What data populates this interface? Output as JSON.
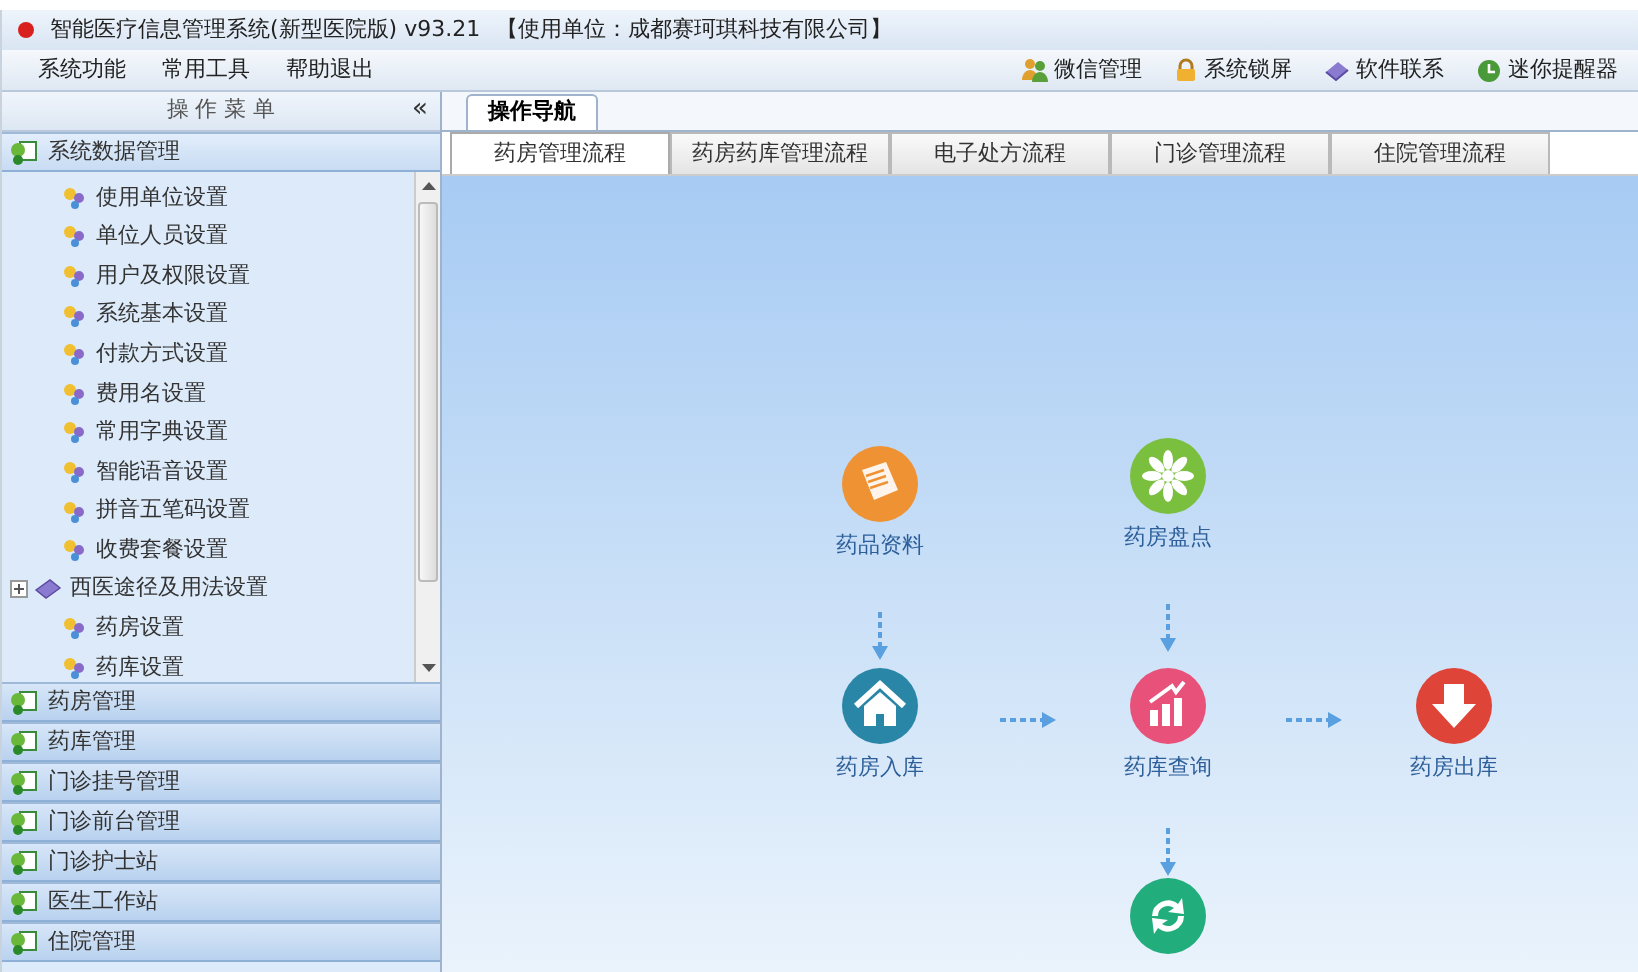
{
  "window": {
    "title": "智能医疗信息管理系统(新型医院版) v93.21",
    "unit": "【使用单位：成都赛珂琪科技有限公司】"
  },
  "menu": [
    "系统功能",
    "常用工具",
    "帮助退出"
  ],
  "toolbar": [
    {
      "label": "微信管理",
      "kind": "people"
    },
    {
      "label": "系统锁屏",
      "kind": "lock"
    },
    {
      "label": "软件联系",
      "kind": "gem"
    },
    {
      "label": "迷你提醒器",
      "kind": "clock"
    }
  ],
  "sidebar": {
    "header": "操 作 菜 单",
    "collapse": "«",
    "groups": [
      {
        "label": "系统数据管理",
        "expanded": true,
        "items": [
          {
            "label": "使用单位设置",
            "kind": "setting"
          },
          {
            "label": "单位人员设置",
            "kind": "setting"
          },
          {
            "label": "用户及权限设置",
            "kind": "setting"
          },
          {
            "label": "系统基本设置",
            "kind": "setting"
          },
          {
            "label": "付款方式设置",
            "kind": "setting"
          },
          {
            "label": "费用名设置",
            "kind": "setting"
          },
          {
            "label": "常用字典设置",
            "kind": "setting"
          },
          {
            "label": "智能语音设置",
            "kind": "setting"
          },
          {
            "label": "拼音五笔码设置",
            "kind": "setting"
          },
          {
            "label": "收费套餐设置",
            "kind": "setting"
          },
          {
            "label": "西医途径及用法设置",
            "kind": "folder",
            "expandable": true
          },
          {
            "label": "药房设置",
            "kind": "setting"
          },
          {
            "label": "药库设置",
            "kind": "setting"
          }
        ]
      },
      {
        "label": "药房管理",
        "expanded": false
      },
      {
        "label": "药库管理",
        "expanded": false
      },
      {
        "label": "门诊挂号管理",
        "expanded": false
      },
      {
        "label": "门诊前台管理",
        "expanded": false
      },
      {
        "label": "门诊护士站",
        "expanded": false
      },
      {
        "label": "医生工作站",
        "expanded": false
      },
      {
        "label": "住院管理",
        "expanded": false
      }
    ]
  },
  "main_tab": "操作导航",
  "flow_tabs": [
    {
      "label": "药房管理流程",
      "selected": true
    },
    {
      "label": "药房药库管理流程",
      "selected": false
    },
    {
      "label": "电子处方流程",
      "selected": false
    },
    {
      "label": "门诊管理流程",
      "selected": false
    },
    {
      "label": "住院管理流程",
      "selected": false
    }
  ],
  "nodes": [
    {
      "label": "药品资料",
      "kind": "document",
      "color": "#ef9234"
    },
    {
      "label": "药房盘点",
      "kind": "flower",
      "color": "#7bbf3f"
    },
    {
      "label": "药房入库",
      "kind": "house",
      "color": "#2a86a6"
    },
    {
      "label": "药库查询",
      "kind": "chart",
      "color": "#e8527a"
    },
    {
      "label": "药房出库",
      "kind": "down",
      "color": "#de4538"
    },
    {
      "kind": "recycle",
      "color": "#22ad7c"
    }
  ]
}
